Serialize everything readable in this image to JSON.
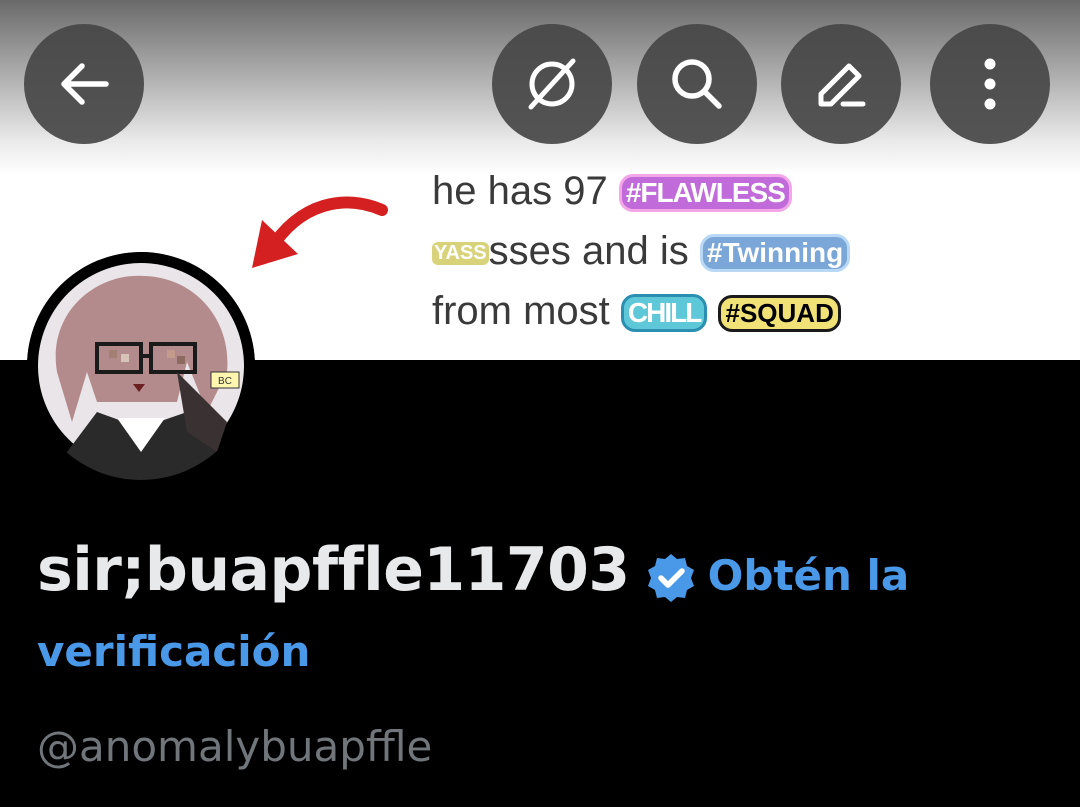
{
  "header": {
    "banner": {
      "meme_line1_text": "he has 97",
      "meme_line1_sticker": "#FLAWLESS",
      "meme_line2_sticker": "YASS",
      "meme_line2_text": "sses and is",
      "meme_line2_sticker2": "#Twinning",
      "meme_line3_text": "from most",
      "meme_line3_sticker": "CHILL",
      "meme_line3_sticker2": "#SQUAD"
    },
    "buttons": {
      "back_icon": "arrow-left-icon",
      "hide_icon": "eye-slash-icon",
      "search_icon": "search-icon",
      "edit_icon": "pencil-icon",
      "more_icon": "more-vertical-icon"
    }
  },
  "profile": {
    "avatar_icon": "avatar",
    "avatar_badge_text": "BC",
    "display_name": "sir;buapffle11703",
    "verified_icon": "verified-badge-icon",
    "get_verified_part1": "Obtén la",
    "get_verified_part2": "verificación",
    "handle": "@anomalybuapffle"
  },
  "colors": {
    "background": "#000000",
    "accent": "#4a99e9",
    "text_primary": "#e7e9ea",
    "text_secondary": "#71767b",
    "nav_button_bg": "#464646"
  }
}
